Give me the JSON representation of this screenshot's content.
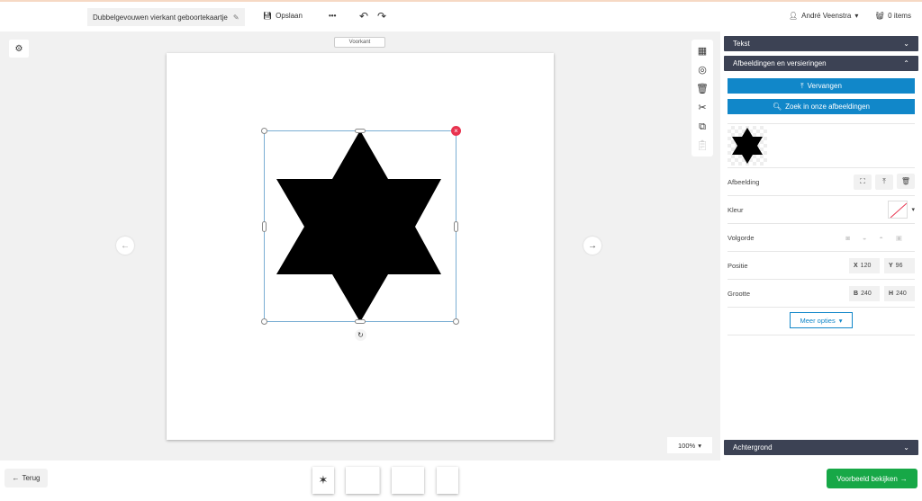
{
  "header": {
    "title": "Dubbelgevouwen vierkant geboortekaartje",
    "save": "Opslaan",
    "more": "•••",
    "user": "André Veenstra",
    "cart": "0 items"
  },
  "canvas": {
    "face_label": "Voorkant",
    "zoom": "100%"
  },
  "panel": {
    "tekst": "Tekst",
    "images": "Afbeeldingen en versieringen",
    "replace": "Vervangen",
    "search": "Zoek in onze afbeeldingen",
    "afbeelding": "Afbeelding",
    "kleur": "Kleur",
    "volgorde": "Volgorde",
    "positie": "Positie",
    "grootte": "Grootte",
    "x_label": "X",
    "x": "120",
    "y_label": "Y",
    "y": "96",
    "b_label": "B",
    "b": "240",
    "h_label": "H",
    "h": "240",
    "more_options": "Meer opties",
    "background": "Achtergrond"
  },
  "footer": {
    "back": "Terug",
    "preview": "Voorbeeld bekijken"
  },
  "colors": {
    "accent": "#1187c9",
    "panel_header": "#3c4254",
    "preview": "#17a847",
    "delete": "#e8334f"
  }
}
